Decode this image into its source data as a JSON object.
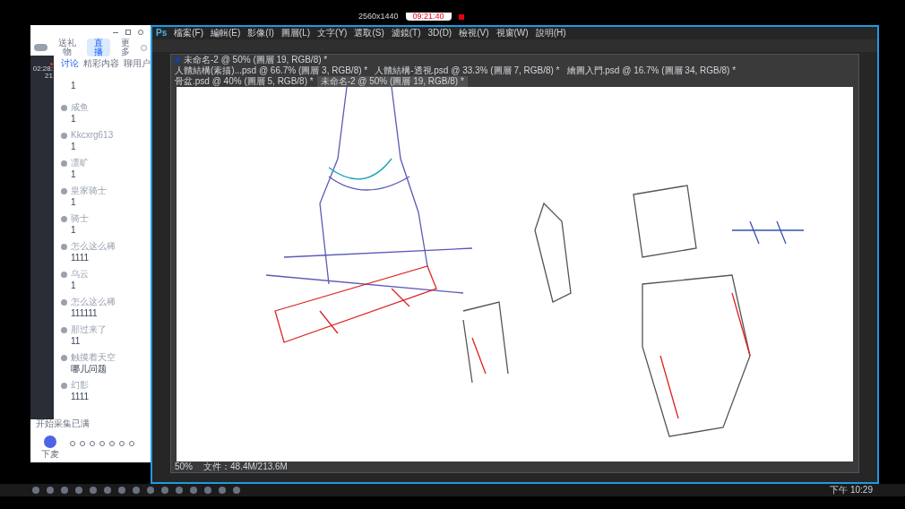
{
  "recorder": {
    "resolution": "2560x1440",
    "timer": "09:21:40"
  },
  "chat_window": {
    "live_time": "02:28:21",
    "top_buttons": [
      {
        "label": "送礼物",
        "selected": false
      },
      {
        "label": "直播",
        "selected": true
      },
      {
        "label": "更多",
        "selected": false
      }
    ],
    "tabs": [
      {
        "label": "讨论",
        "selected": true
      },
      {
        "label": "精彩内容",
        "selected": false
      },
      {
        "label": "聊用户",
        "selected": false
      }
    ],
    "messages": [
      {
        "text": "1"
      },
      {
        "user": "咸鱼",
        "text": "1"
      },
      {
        "user": "Kkcxrg613",
        "text": "1"
      },
      {
        "user": "凛旷",
        "text": "1"
      },
      {
        "user": "皇家骑士",
        "text": "1"
      },
      {
        "user": "骑士",
        "text": "1"
      },
      {
        "user": "怎么这么稀",
        "text": "1111"
      },
      {
        "user": "乌云",
        "text": "1"
      },
      {
        "user": "怎么这么稀",
        "text": "111111"
      },
      {
        "user": "那过来了",
        "text": "11"
      },
      {
        "user": "触摸着天空",
        "text": "哪儿问题"
      },
      {
        "user": "幻影",
        "text": "1111"
      }
    ],
    "footer_note": "开始采集已满",
    "mic_label": "下麦"
  },
  "photoshop": {
    "logo": "Ps",
    "menu": [
      "檔案(F)",
      "編輯(E)",
      "影像(I)",
      "圖層(L)",
      "文字(Y)",
      "選取(S)",
      "濾鏡(T)",
      "3D(D)",
      "檢視(V)",
      "視窗(W)",
      "說明(H)"
    ],
    "document_title": "未命名-2 @ 50% (圖層 19, RGB/8) *",
    "doc_tabs": [
      {
        "label": "人體結構(素描)...psd @ 66.7% (圖層 3, RGB/8) *",
        "selected": false
      },
      {
        "label": "人體結構-透視.psd @ 33.3% (圖層 7, RGB/8) *",
        "selected": false
      },
      {
        "label": "繪圖入門.psd @ 16.7% (圖層 34, RGB/8) *",
        "selected": false
      },
      {
        "label": "骨盆.psd @ 40% (圖層 5, RGB/8) *",
        "selected": false
      },
      {
        "label": "未命名-2 @ 50% (圖層 19, RGB/8) *",
        "selected": true
      }
    ],
    "zoom": "50%",
    "doc_size": "文件：48.4M/213.6M"
  },
  "taskbar": {
    "clock": "下午 10:29"
  }
}
